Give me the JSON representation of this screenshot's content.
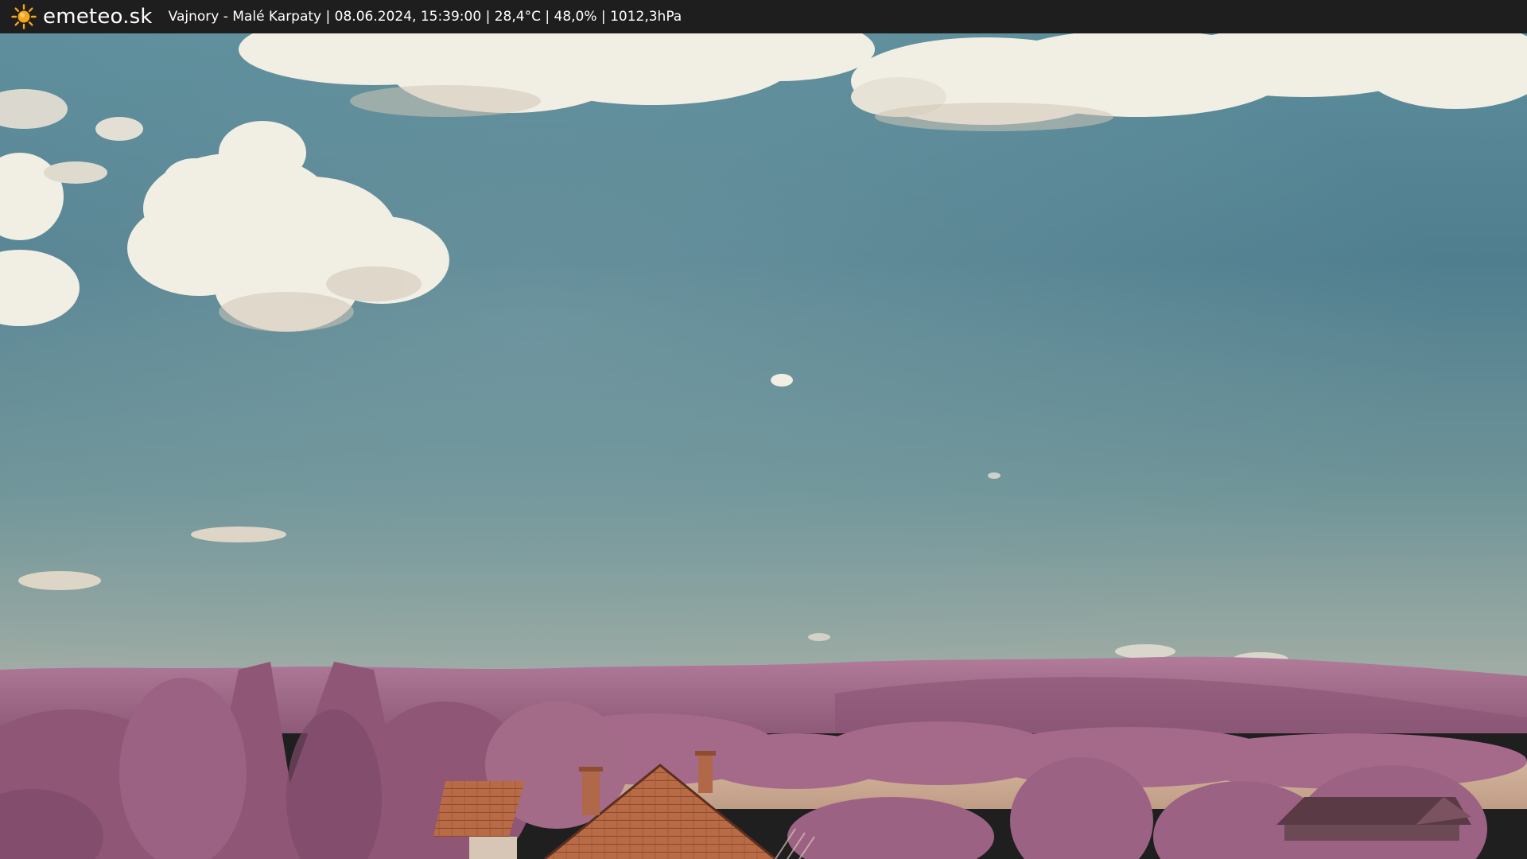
{
  "header": {
    "brand": "emeteo.sk",
    "location": "Vajnory - Malé Karpaty",
    "datetime": "08.06.2024, 15:39:00",
    "temperature": "28,4°C",
    "humidity": "48,0%",
    "pressure": "1012,3hPa",
    "separator": " | "
  },
  "icons": {
    "logo": "sun-icon"
  },
  "colors": {
    "bar": "#1e1e1e",
    "sun": "#f6a51c",
    "sky_top": "#4e7f91",
    "sky_bottom": "#9aa9a3",
    "hills": "#a7708f",
    "trees": "#9a5f80",
    "field": "#c9ab93",
    "roof": "#b86b45"
  }
}
